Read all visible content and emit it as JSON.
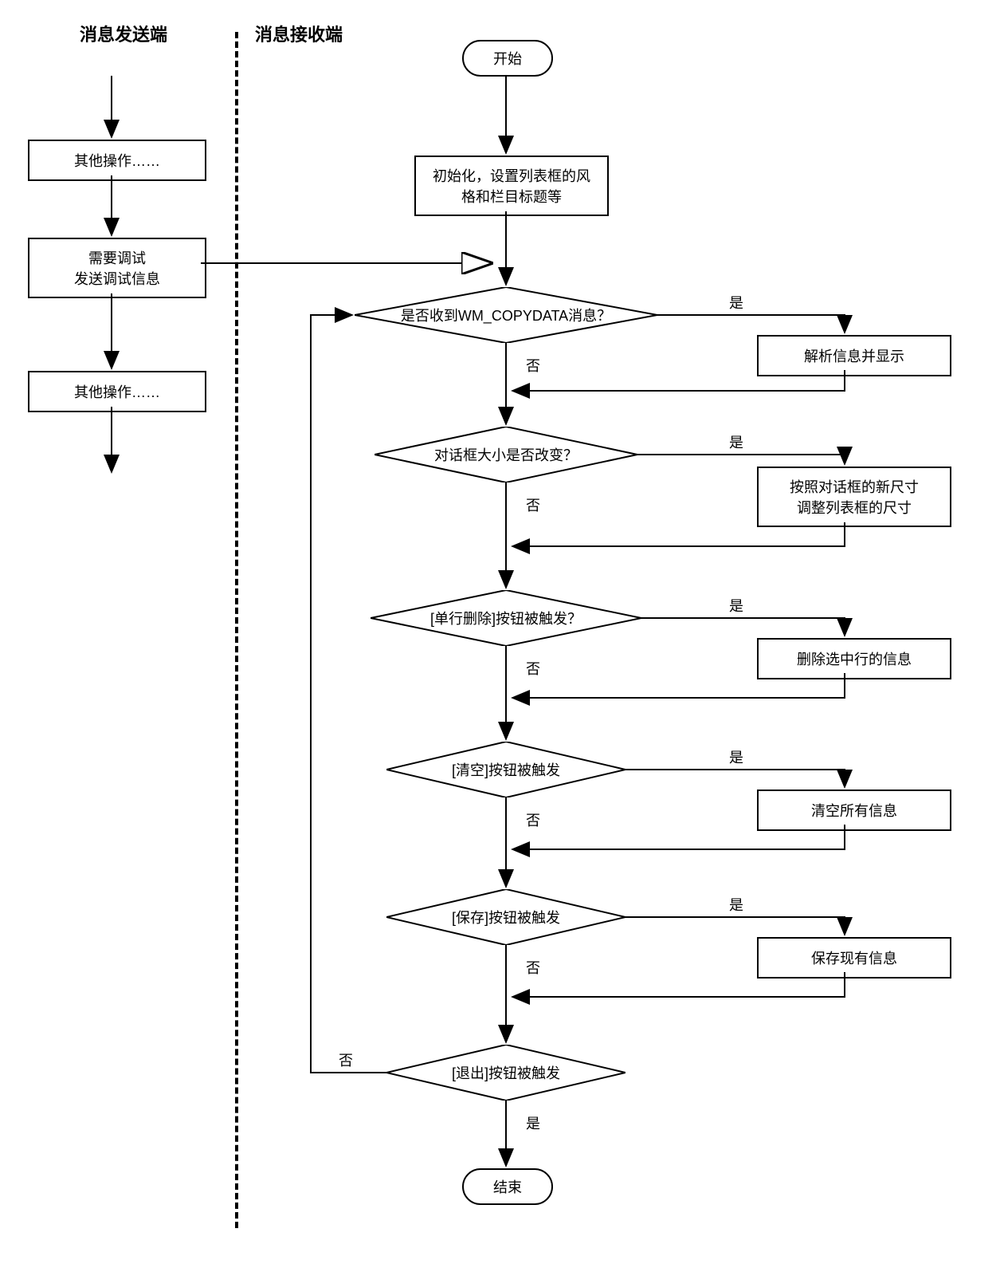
{
  "headings": {
    "sender": "消息发送端",
    "receiver": "消息接收端"
  },
  "sender": {
    "b1": "其他操作……",
    "b2_l1": "需要调试",
    "b2_l2": "发送调试信息",
    "b3": "其他操作……"
  },
  "receiver": {
    "start": "开始",
    "end": "结束",
    "init_l1": "初始化，设置列表框的风",
    "init_l2": "格和栏目标题等",
    "q1": "是否收到WM_COPYDATA消息？",
    "a1": "解析信息并显示",
    "q2": "对话框大小是否改变？",
    "a2_l1": "按照对话框的新尺寸",
    "a2_l2": "调整列表框的尺寸",
    "q3": "[单行删除]按钮被触发？",
    "a3": "删除选中行的信息",
    "q4": "[清空]按钮被触发",
    "a4": "清空所有信息",
    "q5": "[保存]按钮被触发",
    "a5": "保存现有信息",
    "q6": "[退出]按钮被触发"
  },
  "labels": {
    "yes": "是",
    "no": "否"
  }
}
